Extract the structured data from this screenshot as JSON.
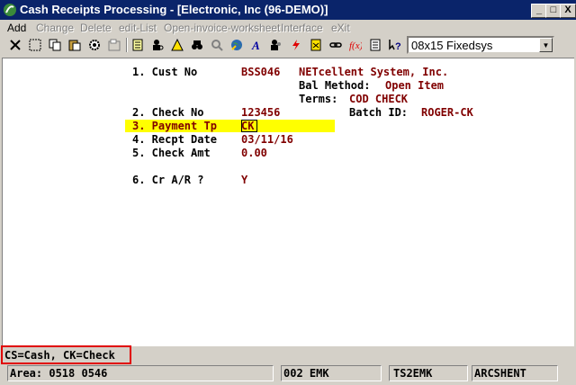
{
  "window": {
    "title": "Cash Receipts Processing - [Electronic, Inc (96-DEMO)]",
    "min_label": "_",
    "max_label": "□",
    "close_label": "X"
  },
  "menu": {
    "items": [
      "Add",
      "Change",
      "Delete",
      "edit-List",
      "Open-invoice-worksheet",
      "Interface",
      "eXit"
    ]
  },
  "toolbar": {
    "icons": [
      "close-icon",
      "select-icon",
      "copy-icon",
      "paste-icon",
      "settings-icon",
      "properties-icon",
      "notes-icon",
      "user-lookup-icon",
      "warning-icon",
      "binoculars-icon",
      "zoom-icon",
      "globe-icon",
      "font-icon",
      "users-icon",
      "lightning-icon",
      "calculator-icon",
      "link-icon",
      "function-icon",
      "list-icon",
      "help-icon"
    ],
    "font_value": "08x15 Fixedsys"
  },
  "form": {
    "f1_label": "1. Cust No",
    "f1_value": "BSS046",
    "cust_name": "NETcellent System, Inc.",
    "bal_label": "Bal Method:",
    "bal_value": "Open Item",
    "terms_label": "Terms:",
    "terms_value": "COD CHECK",
    "f2_label": "2. Check No",
    "f2_value": "123456",
    "batch_label": "Batch ID:",
    "batch_value": "ROGER-CK",
    "f3_label": "3. Payment Tp",
    "f3_value": "CK",
    "f4_label": "4. Recpt Date",
    "f4_value": "03/11/16",
    "f5_label": "5. Check Amt",
    "f5_value": "0.00",
    "f6_label": "6. Cr A/R ?",
    "f6_value": "Y"
  },
  "message": "CS=Cash, CK=Check",
  "status": {
    "area": "Area: 0518 0546",
    "user": "002 EMK",
    "terminal": "TS2EMK",
    "company": "ARCSHENT"
  }
}
